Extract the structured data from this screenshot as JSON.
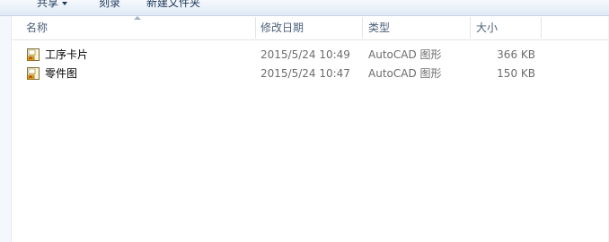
{
  "toolbar": {
    "items": [
      {
        "label": "共享"
      },
      {
        "label": "刻录"
      },
      {
        "label": "新建文件夹"
      }
    ]
  },
  "columns": {
    "name": "名称",
    "date": "修改日期",
    "type": "类型",
    "size": "大小"
  },
  "files": [
    {
      "name": "工序卡片",
      "date": "2015/5/24 10:49",
      "type": "AutoCAD 图形",
      "size": "366 KB",
      "icon": "autocad-drawing-icon"
    },
    {
      "name": "零件图",
      "date": "2015/5/24 10:47",
      "type": "AutoCAD 图形",
      "size": "150 KB",
      "icon": "autocad-drawing-icon"
    }
  ],
  "colors": {
    "header_text": "#4c607a",
    "meta_text": "#6d6d6d",
    "toolbar_text": "#1e395b"
  }
}
